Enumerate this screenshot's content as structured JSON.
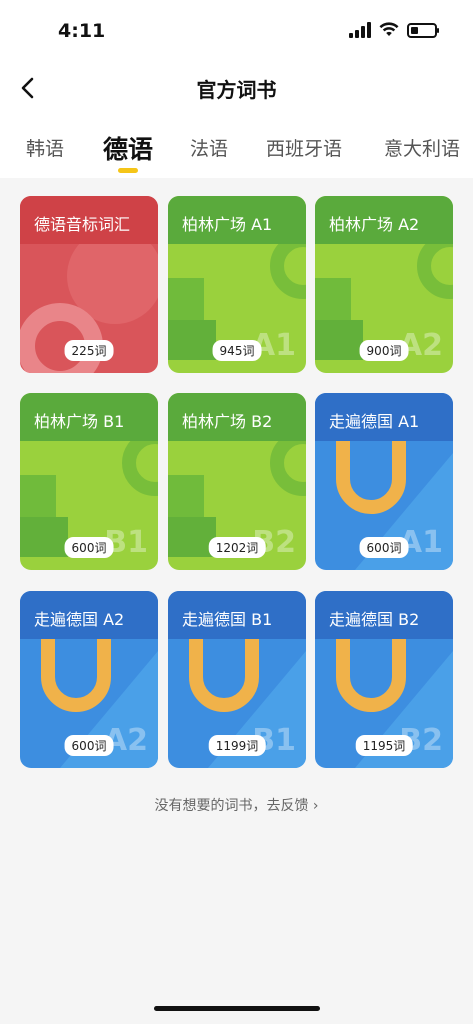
{
  "status": {
    "time": "4:11",
    "battery_level": 0.3
  },
  "nav": {
    "title": "官方词书"
  },
  "tabs": [
    {
      "label": "韩语"
    },
    {
      "label": "德语",
      "active": true
    },
    {
      "label": "法语"
    },
    {
      "label": "西班牙语"
    },
    {
      "label": "意大利语"
    }
  ],
  "books": [
    {
      "title": "德语音标词汇",
      "count": "225词",
      "level": "",
      "theme": "red"
    },
    {
      "title": "柏林广场 A1",
      "count": "945词",
      "level": "A1",
      "theme": "green"
    },
    {
      "title": "柏林广场 A2",
      "count": "900词",
      "level": "A2",
      "theme": "green"
    },
    {
      "title": "柏林广场 B1",
      "count": "600词",
      "level": "B1",
      "theme": "green"
    },
    {
      "title": "柏林广场 B2",
      "count": "1202词",
      "level": "B2",
      "theme": "green"
    },
    {
      "title": "走遍德国 A1",
      "count": "600词",
      "level": "A1",
      "theme": "blue"
    },
    {
      "title": "走遍德国 A2",
      "count": "600词",
      "level": "A2",
      "theme": "blue"
    },
    {
      "title": "走遍德国 B1",
      "count": "1199词",
      "level": "B1",
      "theme": "blue"
    },
    {
      "title": "走遍德国 B2",
      "count": "1195词",
      "level": "B2",
      "theme": "blue"
    }
  ],
  "feedback": {
    "text": "没有想要的词书，去反馈",
    "arrow": "›"
  },
  "colors": {
    "accent": "#f5c518",
    "red": "#d9555a",
    "green": "#9ad13d",
    "blue": "#3d8ee0"
  }
}
